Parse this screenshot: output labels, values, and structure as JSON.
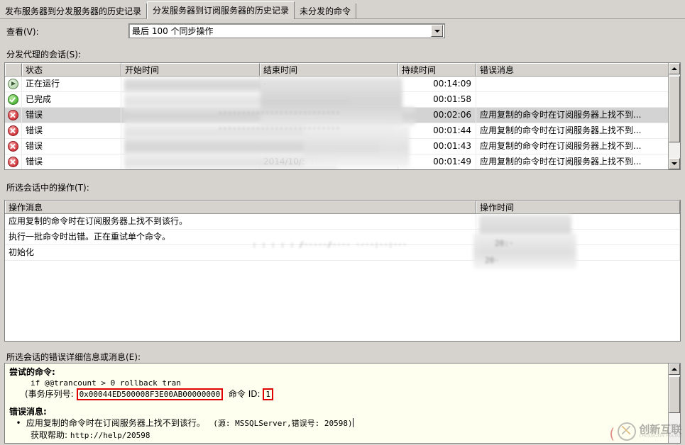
{
  "tabs": [
    {
      "label": "发布服务器到分发服务器的历史记录",
      "active": false
    },
    {
      "label": "分发服务器到订阅服务器的历史记录",
      "active": true
    },
    {
      "label": "未分发的命令",
      "active": false
    }
  ],
  "view": {
    "label": "查看(V):",
    "selected": "最后 100 个同步操作"
  },
  "sessions": {
    "label": "分发代理的会话(S):",
    "columns": [
      "",
      "状态",
      "开始时间",
      "结束时间",
      "持续时间",
      "错误消息"
    ],
    "rows": [
      {
        "icon": "running-icon",
        "status": "正在运行",
        "start": "",
        "end": "-",
        "duration": "00:14:09",
        "error": ""
      },
      {
        "icon": "success-icon",
        "status": "已完成",
        "start": "",
        "end": "",
        "duration": "00:01:58",
        "error": ""
      },
      {
        "icon": "error-icon",
        "status": "错误",
        "start": "",
        "end": "",
        "duration": "00:02:06",
        "error": "应用复制的命令时在订阅服务器上找不到..."
      },
      {
        "icon": "error-icon",
        "status": "错误",
        "start": "",
        "end": "",
        "duration": "00:01:44",
        "error": "应用复制的命令时在订阅服务器上找不到..."
      },
      {
        "icon": "error-icon",
        "status": "错误",
        "start": "",
        "end": "",
        "duration": "00:01:43",
        "error": "应用复制的命令时在订阅服务器上找不到..."
      },
      {
        "icon": "error-icon",
        "status": "错误",
        "start": "",
        "end": "2014/10/5 10:",
        "duration": "00:01:49",
        "error": "应用复制的命令时在订阅服务器上找不到..."
      }
    ],
    "selected_row_index": 2
  },
  "actions": {
    "label": "所选会话中的操作(T):",
    "columns": [
      "操作消息",
      "操作时间"
    ],
    "rows": [
      {
        "message": "应用复制的命令时在订阅服务器上找不到该行。",
        "time": ""
      },
      {
        "message": "执行一批命令时出错。正在重试单个命令。",
        "time": ""
      },
      {
        "message": "初始化",
        "time": ""
      }
    ]
  },
  "details": {
    "label": "所选会话的错误详细信息或消息(E):",
    "attempted_command_heading": "尝试的命令:",
    "attempted_command_code": "if @@trancount > 0 rollback tran",
    "lsn_prefix": "(事务序列号:",
    "lsn_value": "0x00044ED500008F3E00AB00000000",
    "command_id_label": "命令 ID:",
    "command_id_value": "1",
    "error_heading": "错误消息:",
    "error_text": "应用复制的命令时在订阅服务器上找不到该行。",
    "error_source": "(源: MSSQLServer,错误号: 20598)",
    "help_label": "获取帮助:",
    "help_url": "http://help/20598"
  },
  "watermark": {
    "cn": "创新互联",
    "en": "CHUANGXIN HULIAN"
  },
  "colors": {
    "accent_red": "#e00000",
    "panel_cream": "#fffff0",
    "chrome": "#d6d3ce"
  }
}
